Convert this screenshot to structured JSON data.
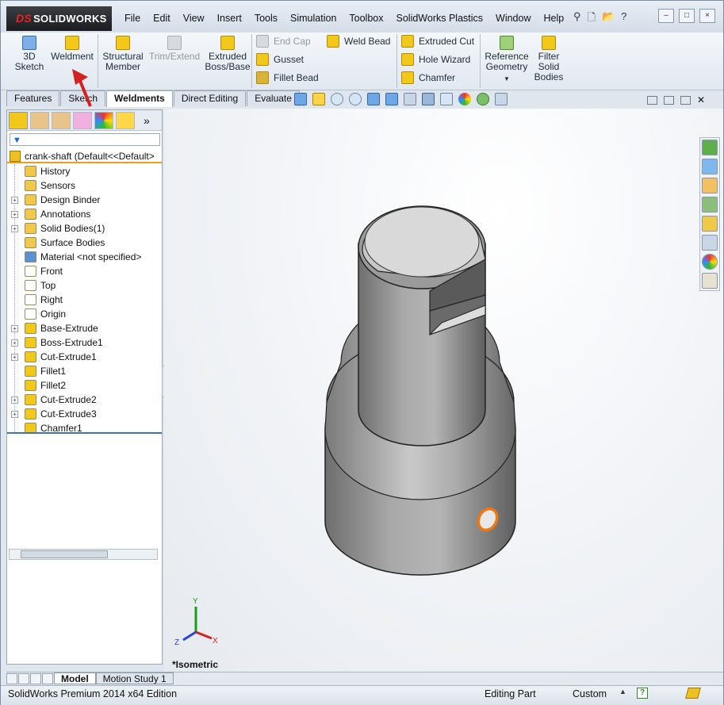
{
  "app": {
    "logo": "SOLIDWORKS",
    "logo_prefix": "DS"
  },
  "menu": [
    "File",
    "Edit",
    "View",
    "Insert",
    "Tools",
    "Simulation",
    "Toolbox",
    "SolidWorks Plastics",
    "Window",
    "Help"
  ],
  "quick_access": {
    "pin": "⚲",
    "new": "🗋",
    "open": "📂",
    "arrow": "▾",
    "help": "?"
  },
  "window_buttons": {
    "min": "–",
    "max": "□",
    "close": "×"
  },
  "command_manager": {
    "sketch3d": "3D\nSketch",
    "weldment": "Weldment",
    "structural_member": "Structural\nMember",
    "trim_extend": "Trim/Extend",
    "extruded_boss": "Extruded\nBoss/Base",
    "end_cap": "End Cap",
    "gusset": "Gusset",
    "fillet_bead": "Fillet Bead",
    "weld_bead": "Weld Bead",
    "extruded_cut": "Extruded Cut",
    "hole_wizard": "Hole Wizard",
    "chamfer": "Chamfer",
    "reference_geometry": "Reference\nGeometry",
    "filter_solid_bodies": "Filter\nSolid\nBodies"
  },
  "tabs": [
    "Features",
    "Sketch",
    "Weldments",
    "Direct Editing",
    "Evaluate"
  ],
  "active_tab": "Weldments",
  "feature_tree": {
    "root": "crank-shaft  (Default<<Default>",
    "filter_icon": "▼",
    "collapse_icon": "»",
    "items": [
      {
        "label": "History",
        "expand": false,
        "color": "#f1c84a"
      },
      {
        "label": "Sensors",
        "expand": false,
        "color": "#f1c84a"
      },
      {
        "label": "Design Binder",
        "expand": true,
        "color": "#f1c84a"
      },
      {
        "label": "Annotations",
        "expand": true,
        "color": "#f1c84a"
      },
      {
        "label": "Solid Bodies(1)",
        "expand": true,
        "color": "#f1c84a"
      },
      {
        "label": "Surface Bodies",
        "expand": false,
        "color": "#f1c84a"
      },
      {
        "label": "Material <not specified>",
        "expand": false,
        "color": "#5b8fd6"
      },
      {
        "label": "Front",
        "expand": false,
        "color": "#ffffff"
      },
      {
        "label": "Top",
        "expand": false,
        "color": "#ffffff"
      },
      {
        "label": "Right",
        "expand": false,
        "color": "#ffffff"
      },
      {
        "label": "Origin",
        "expand": false,
        "color": "#ffffff"
      },
      {
        "label": "Base-Extrude",
        "expand": true,
        "color": "#f2c81b"
      },
      {
        "label": "Boss-Extrude1",
        "expand": true,
        "color": "#f2c81b"
      },
      {
        "label": "Cut-Extrude1",
        "expand": true,
        "color": "#f2c81b"
      },
      {
        "label": "Fillet1",
        "expand": false,
        "color": "#f2c81b"
      },
      {
        "label": "Fillet2",
        "expand": false,
        "color": "#f2c81b"
      },
      {
        "label": "Cut-Extrude2",
        "expand": true,
        "color": "#f2c81b"
      },
      {
        "label": "Cut-Extrude3",
        "expand": true,
        "color": "#f2c81b"
      },
      {
        "label": "Chamfer1",
        "expand": false,
        "color": "#f2c81b"
      }
    ]
  },
  "graphics": {
    "view_label": "*Isometric"
  },
  "bottom_tabs": [
    "Model",
    "Motion Study 1"
  ],
  "status": {
    "edition": "SolidWorks Premium 2014 x64 Edition",
    "mode": "Editing Part",
    "units": "Custom",
    "help": "?"
  },
  "colors": {
    "accent": "#e8a020",
    "part_gray": "#8f8f8f",
    "annotation_arrow": "#d32222"
  }
}
